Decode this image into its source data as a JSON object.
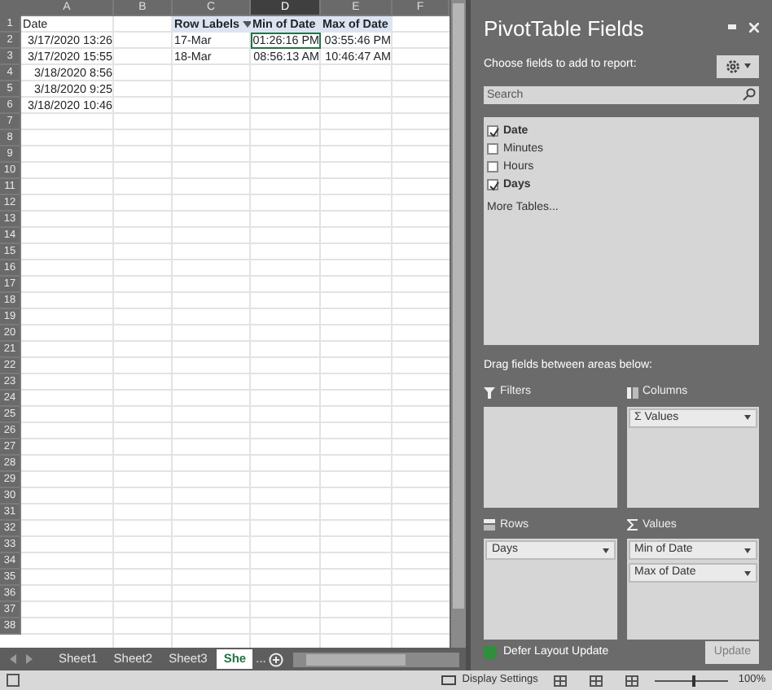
{
  "sheet": {
    "columns": [
      {
        "label": "A",
        "selected": false
      },
      {
        "label": "B",
        "selected": false
      },
      {
        "label": "C",
        "selected": false
      },
      {
        "label": "D",
        "selected": true
      },
      {
        "label": "E",
        "selected": false
      },
      {
        "label": "F",
        "selected": false
      }
    ],
    "rows": [
      {
        "number": "1",
        "cells": [
          {
            "text": "Date",
            "kind": "text",
            "selected": false
          },
          null,
          {
            "text": "Row Labels",
            "kind": "pivot-header",
            "filter": true,
            "selected": false
          },
          {
            "text": "Min of Date",
            "kind": "pivot-header",
            "selected": false
          },
          {
            "text": "Max of Date",
            "kind": "pivot-header",
            "selected": false
          },
          null
        ]
      },
      {
        "number": "2",
        "cells": [
          {
            "text": "3/17/2020 13:26",
            "kind": "number",
            "selected": false
          },
          null,
          {
            "text": "17-Mar",
            "kind": "text",
            "selected": false
          },
          {
            "text": "01:26:16 PM",
            "kind": "number",
            "selected": true
          },
          {
            "text": "03:55:46 PM",
            "kind": "number",
            "selected": false
          },
          null
        ]
      },
      {
        "number": "3",
        "cells": [
          {
            "text": "3/17/2020 15:55",
            "kind": "number",
            "selected": false
          },
          null,
          {
            "text": "18-Mar",
            "kind": "text",
            "selected": false
          },
          {
            "text": "08:56:13 AM",
            "kind": "number",
            "selected": false
          },
          {
            "text": "10:46:47 AM",
            "kind": "number",
            "selected": false
          },
          null
        ]
      },
      {
        "number": "4",
        "cells": [
          {
            "text": "3/18/2020 8:56",
            "kind": "number",
            "selected": false
          }
        ]
      },
      {
        "number": "5",
        "cells": [
          {
            "text": "3/18/2020 9:25",
            "kind": "number",
            "selected": false
          }
        ]
      },
      {
        "number": "6",
        "cells": [
          {
            "text": "3/18/2020 10:46",
            "kind": "number",
            "selected": false
          }
        ]
      },
      {
        "number": "7"
      },
      {
        "number": "8"
      },
      {
        "number": "9"
      },
      {
        "number": "10"
      },
      {
        "number": "11"
      },
      {
        "number": "12"
      },
      {
        "number": "13"
      },
      {
        "number": "14"
      },
      {
        "number": "15"
      },
      {
        "number": "16"
      },
      {
        "number": "17"
      },
      {
        "number": "18"
      },
      {
        "number": "19"
      },
      {
        "number": "20"
      },
      {
        "number": "21"
      },
      {
        "number": "22"
      },
      {
        "number": "23"
      },
      {
        "number": "24"
      },
      {
        "number": "25"
      },
      {
        "number": "26"
      },
      {
        "number": "27"
      },
      {
        "number": "28"
      },
      {
        "number": "29"
      },
      {
        "number": "30"
      },
      {
        "number": "31"
      },
      {
        "number": "32"
      },
      {
        "number": "33"
      },
      {
        "number": "34"
      },
      {
        "number": "35"
      },
      {
        "number": "36"
      },
      {
        "number": "37"
      },
      {
        "number": "38"
      }
    ],
    "tabs": [
      {
        "label": "Sheet1",
        "selected": false
      },
      {
        "label": "Sheet2",
        "selected": false
      },
      {
        "label": "Sheet3",
        "selected": false
      },
      {
        "label": "She",
        "selected": true
      }
    ],
    "more_tabs": "..."
  },
  "pivot_panel": {
    "title": "PivotTable Fields",
    "instruction": "Choose fields to add to report:",
    "search": {
      "placeholder": "Search"
    },
    "fields": [
      {
        "label": "Date",
        "checked": true
      },
      {
        "label": "Minutes",
        "checked": false
      },
      {
        "label": "Hours",
        "checked": false
      },
      {
        "label": "Days",
        "checked": true
      }
    ],
    "more_tables": "More Tables...",
    "drag_hint": "Drag fields between areas below:",
    "areas": [
      {
        "kind": "filters",
        "label": "Filters"
      },
      {
        "kind": "columns",
        "label": "Columns",
        "items": [
          "Σ Values"
        ]
      },
      {
        "kind": "rows",
        "label": "Rows",
        "items": [
          "Days"
        ]
      },
      {
        "kind": "values",
        "label": "Values",
        "items": [
          "Min of Date",
          "Max of Date"
        ]
      }
    ],
    "defer": {
      "label": "Defer Layout Update",
      "checked": true
    },
    "update_button": {
      "label": "Update",
      "disabled": true
    }
  },
  "status_bar": {
    "display_settings": "Display Settings",
    "zoom": {
      "level": 0.5,
      "reading": "100%"
    }
  }
}
